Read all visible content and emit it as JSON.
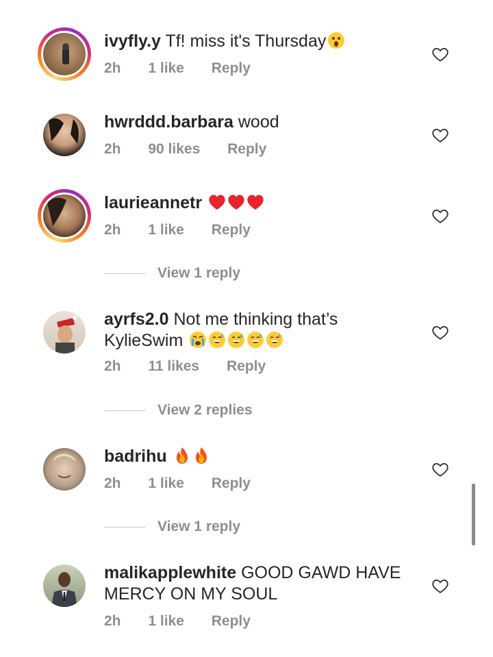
{
  "comments": [
    {
      "username": "ivyfly.y",
      "text": "Tf! miss it's Thursday",
      "time": "2h",
      "likes": "1 like",
      "reply": "Reply",
      "emojis": [
        "hushed-face"
      ]
    },
    {
      "username": "hwrddd.barbara",
      "text": "wood",
      "time": "2h",
      "likes": "90 likes",
      "reply": "Reply",
      "emojis": []
    },
    {
      "username": "laurieannetr",
      "text": "",
      "time": "2h",
      "likes": "1 like",
      "reply": "Reply",
      "emojis": [
        "red-heart",
        "red-heart",
        "red-heart"
      ],
      "view_replies": "View 1 reply"
    },
    {
      "username": "ayrfs2.0",
      "text": "Not me thinking that’s",
      "text_line2": "KylieSwim",
      "time": "2h",
      "likes": "11 likes",
      "reply": "Reply",
      "emojis": [
        "crying-face",
        "grinning-sweat",
        "grinning-sweat",
        "grinning-sweat",
        "grinning-sweat"
      ],
      "view_replies": "View 2 replies"
    },
    {
      "username": "badrihu",
      "text": "",
      "time": "2h",
      "likes": "1 like",
      "reply": "Reply",
      "emojis": [
        "fire",
        "fire"
      ],
      "view_replies": "View 1 reply"
    },
    {
      "username": "malikapplewhite",
      "text": "GOOD GAWD HAVE",
      "text_line2": "MERCY ON MY SOUL",
      "time": "2h",
      "likes": "1 like",
      "reply": "Reply",
      "emojis": []
    }
  ],
  "colors": {
    "text": "#262626",
    "meta": "#8e8e8e",
    "heart_red": "#e0245e"
  }
}
